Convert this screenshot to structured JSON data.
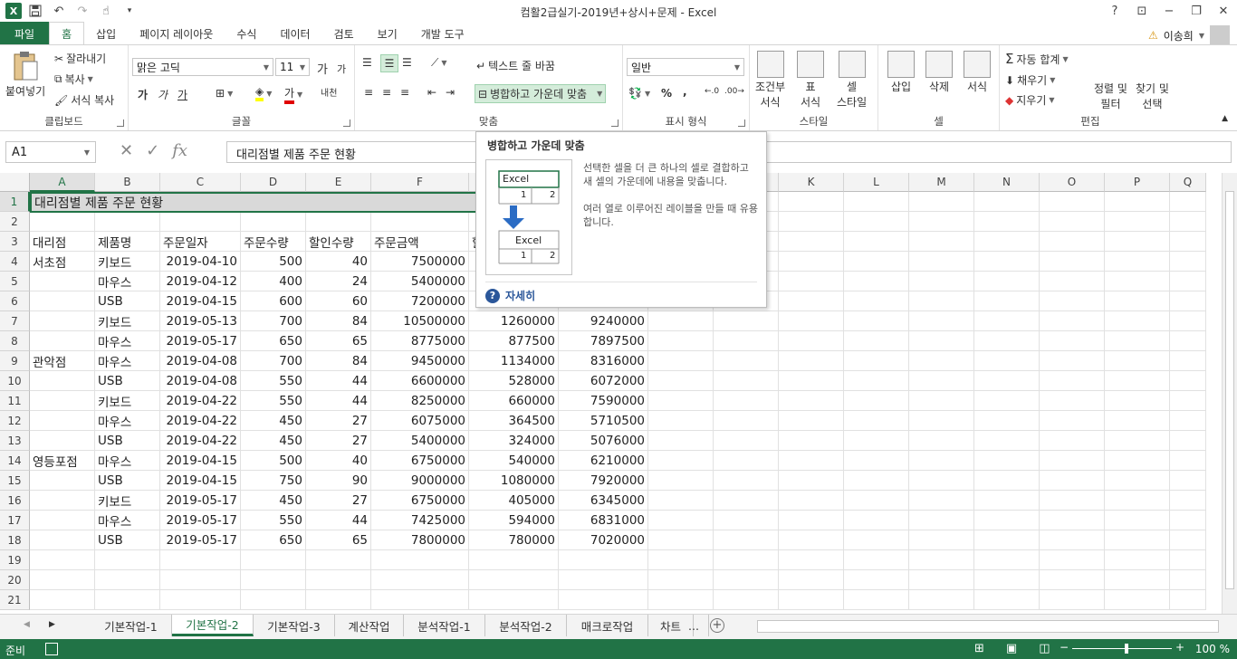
{
  "window": {
    "title": "컴활2급실기-2019년+상시+문제 - Excel",
    "help_icon": "?",
    "min_icon": "−",
    "max_icon": "❐",
    "close_icon": "✕"
  },
  "tabs": [
    "파일",
    "홈",
    "삽입",
    "페이지 레이아웃",
    "수식",
    "데이터",
    "검토",
    "보기",
    "개발 도구"
  ],
  "user": "이송희",
  "ribbon": {
    "clipboard": {
      "paste": "붙여넣기",
      "cut": "잘라내기",
      "copy": "복사",
      "format_painter": "서식 복사",
      "label": "클립보드"
    },
    "font": {
      "name": "맑은 고딕",
      "size": "11",
      "label": "글꼴",
      "grow": "가",
      "shrink": "가",
      "bold": "가",
      "italic": "가",
      "underline": "가",
      "color": "가",
      "phonetic": "내천"
    },
    "alignment": {
      "wrap": "텍스트 줄 바꿈",
      "merge": "병합하고 가운데 맞춤",
      "label": "맞춤"
    },
    "number": {
      "format": "일반",
      "label": "표시 형식",
      "percent": "%",
      "comma": ","
    },
    "styles": {
      "conditional": "조건부\n서식",
      "table": "표\n서식",
      "cell": "셀\n스타일",
      "label": "스타일"
    },
    "cells": {
      "insert": "삽입",
      "delete": "삭제",
      "format": "서식",
      "label": "셀"
    },
    "editing": {
      "autosum": "자동 합계",
      "fill": "채우기",
      "clear": "지우기",
      "sort": "정렬 및\n필터",
      "find": "찾기 및\n선택",
      "label": "편집"
    }
  },
  "formula_bar": {
    "name_box": "A1",
    "formula": "대리점별 제품 주문 현황",
    "fx": "fx"
  },
  "tooltip": {
    "title": "병합하고 가운데 맞춤",
    "desc1": "선택한 셀을 더 큰 하나의 셀로 결합하고 새 셀의 가운데에 내용을 맞춥니다.",
    "desc2": "여러 열로 이루어진 레이블을 만들 때 유용합니다.",
    "more": "자세히",
    "excel_label": "Excel",
    "one": "1",
    "two": "2"
  },
  "columns": [
    "A",
    "B",
    "C",
    "D",
    "E",
    "F",
    "G",
    "H",
    "I",
    "J",
    "K",
    "L",
    "M",
    "N",
    "O",
    "P",
    "Q"
  ],
  "rows_numbers": [
    "1",
    "2",
    "3",
    "4",
    "5",
    "6",
    "7",
    "8",
    "9",
    "10",
    "11",
    "12",
    "13",
    "14",
    "15",
    "16",
    "17",
    "18",
    "19",
    "20",
    "21"
  ],
  "sheet": {
    "a1": "대리점별 제품 주문 현황",
    "headers": [
      "대리점",
      "제품명",
      "주문일자",
      "주문수량",
      "할인수량",
      "주문금액",
      "할",
      ""
    ],
    "rows": [
      [
        "서초점",
        "키보드",
        "2019-04-10",
        "500",
        "40",
        "7500000",
        "",
        ""
      ],
      [
        "",
        "마우스",
        "2019-04-12",
        "400",
        "24",
        "5400000",
        "",
        ""
      ],
      [
        "",
        "USB",
        "2019-04-15",
        "600",
        "60",
        "7200000",
        "",
        ""
      ],
      [
        "",
        "키보드",
        "2019-05-13",
        "700",
        "84",
        "10500000",
        "1260000",
        "9240000"
      ],
      [
        "",
        "마우스",
        "2019-05-17",
        "650",
        "65",
        "8775000",
        "877500",
        "7897500"
      ],
      [
        "관악점",
        "마우스",
        "2019-04-08",
        "700",
        "84",
        "9450000",
        "1134000",
        "8316000"
      ],
      [
        "",
        "USB",
        "2019-04-08",
        "550",
        "44",
        "6600000",
        "528000",
        "6072000"
      ],
      [
        "",
        "키보드",
        "2019-04-22",
        "550",
        "44",
        "8250000",
        "660000",
        "7590000"
      ],
      [
        "",
        "마우스",
        "2019-04-22",
        "450",
        "27",
        "6075000",
        "364500",
        "5710500"
      ],
      [
        "",
        "USB",
        "2019-04-22",
        "450",
        "27",
        "5400000",
        "324000",
        "5076000"
      ],
      [
        "영등포점",
        "마우스",
        "2019-04-15",
        "500",
        "40",
        "6750000",
        "540000",
        "6210000"
      ],
      [
        "",
        "USB",
        "2019-04-15",
        "750",
        "90",
        "9000000",
        "1080000",
        "7920000"
      ],
      [
        "",
        "키보드",
        "2019-05-17",
        "450",
        "27",
        "6750000",
        "405000",
        "6345000"
      ],
      [
        "",
        "마우스",
        "2019-05-17",
        "550",
        "44",
        "7425000",
        "594000",
        "6831000"
      ],
      [
        "",
        "USB",
        "2019-05-17",
        "650",
        "65",
        "7800000",
        "780000",
        "7020000"
      ]
    ]
  },
  "sheet_tabs": [
    "기본작업-1",
    "기본작업-2",
    "기본작업-3",
    "계산작업",
    "분석작업-1",
    "분석작업-2",
    "매크로작업",
    "차트"
  ],
  "sheet_tabs_more": "...",
  "status": {
    "ready": "준비",
    "zoom": "100 %"
  },
  "colors": {
    "accent": "#217346",
    "merge_fill": "#d9d9d9"
  }
}
